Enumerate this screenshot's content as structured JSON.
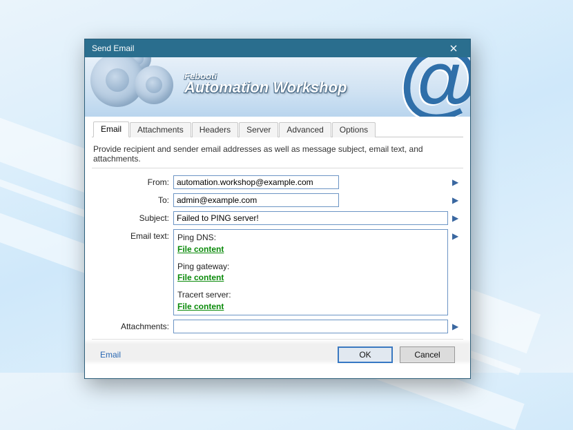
{
  "window": {
    "title": "Send Email"
  },
  "brand": {
    "sub": "Febooti",
    "main": "Automation Workshop"
  },
  "tabs": [
    "Email",
    "Attachments",
    "Headers",
    "Server",
    "Advanced",
    "Options"
  ],
  "active_tab": 0,
  "description": "Provide recipient and sender email addresses as well as message subject, email text, and attachments.",
  "form": {
    "from_label": "From:",
    "from_value": "automation.workshop@example.com",
    "to_label": "To:",
    "to_value": "admin@example.com",
    "subject_label": "Subject:",
    "subject_value": "Failed to PING server!",
    "emailtext_label": "Email text:",
    "emailtext": {
      "line1": "Ping DNS:",
      "link1": "File content",
      "line2": "Ping gateway:",
      "link2": "File content",
      "line3": "Tracert server:",
      "link3": "File content"
    },
    "attachments_label": "Attachments:",
    "attachments_value": ""
  },
  "footer": {
    "help": "Email",
    "ok": "OK",
    "cancel": "Cancel"
  }
}
